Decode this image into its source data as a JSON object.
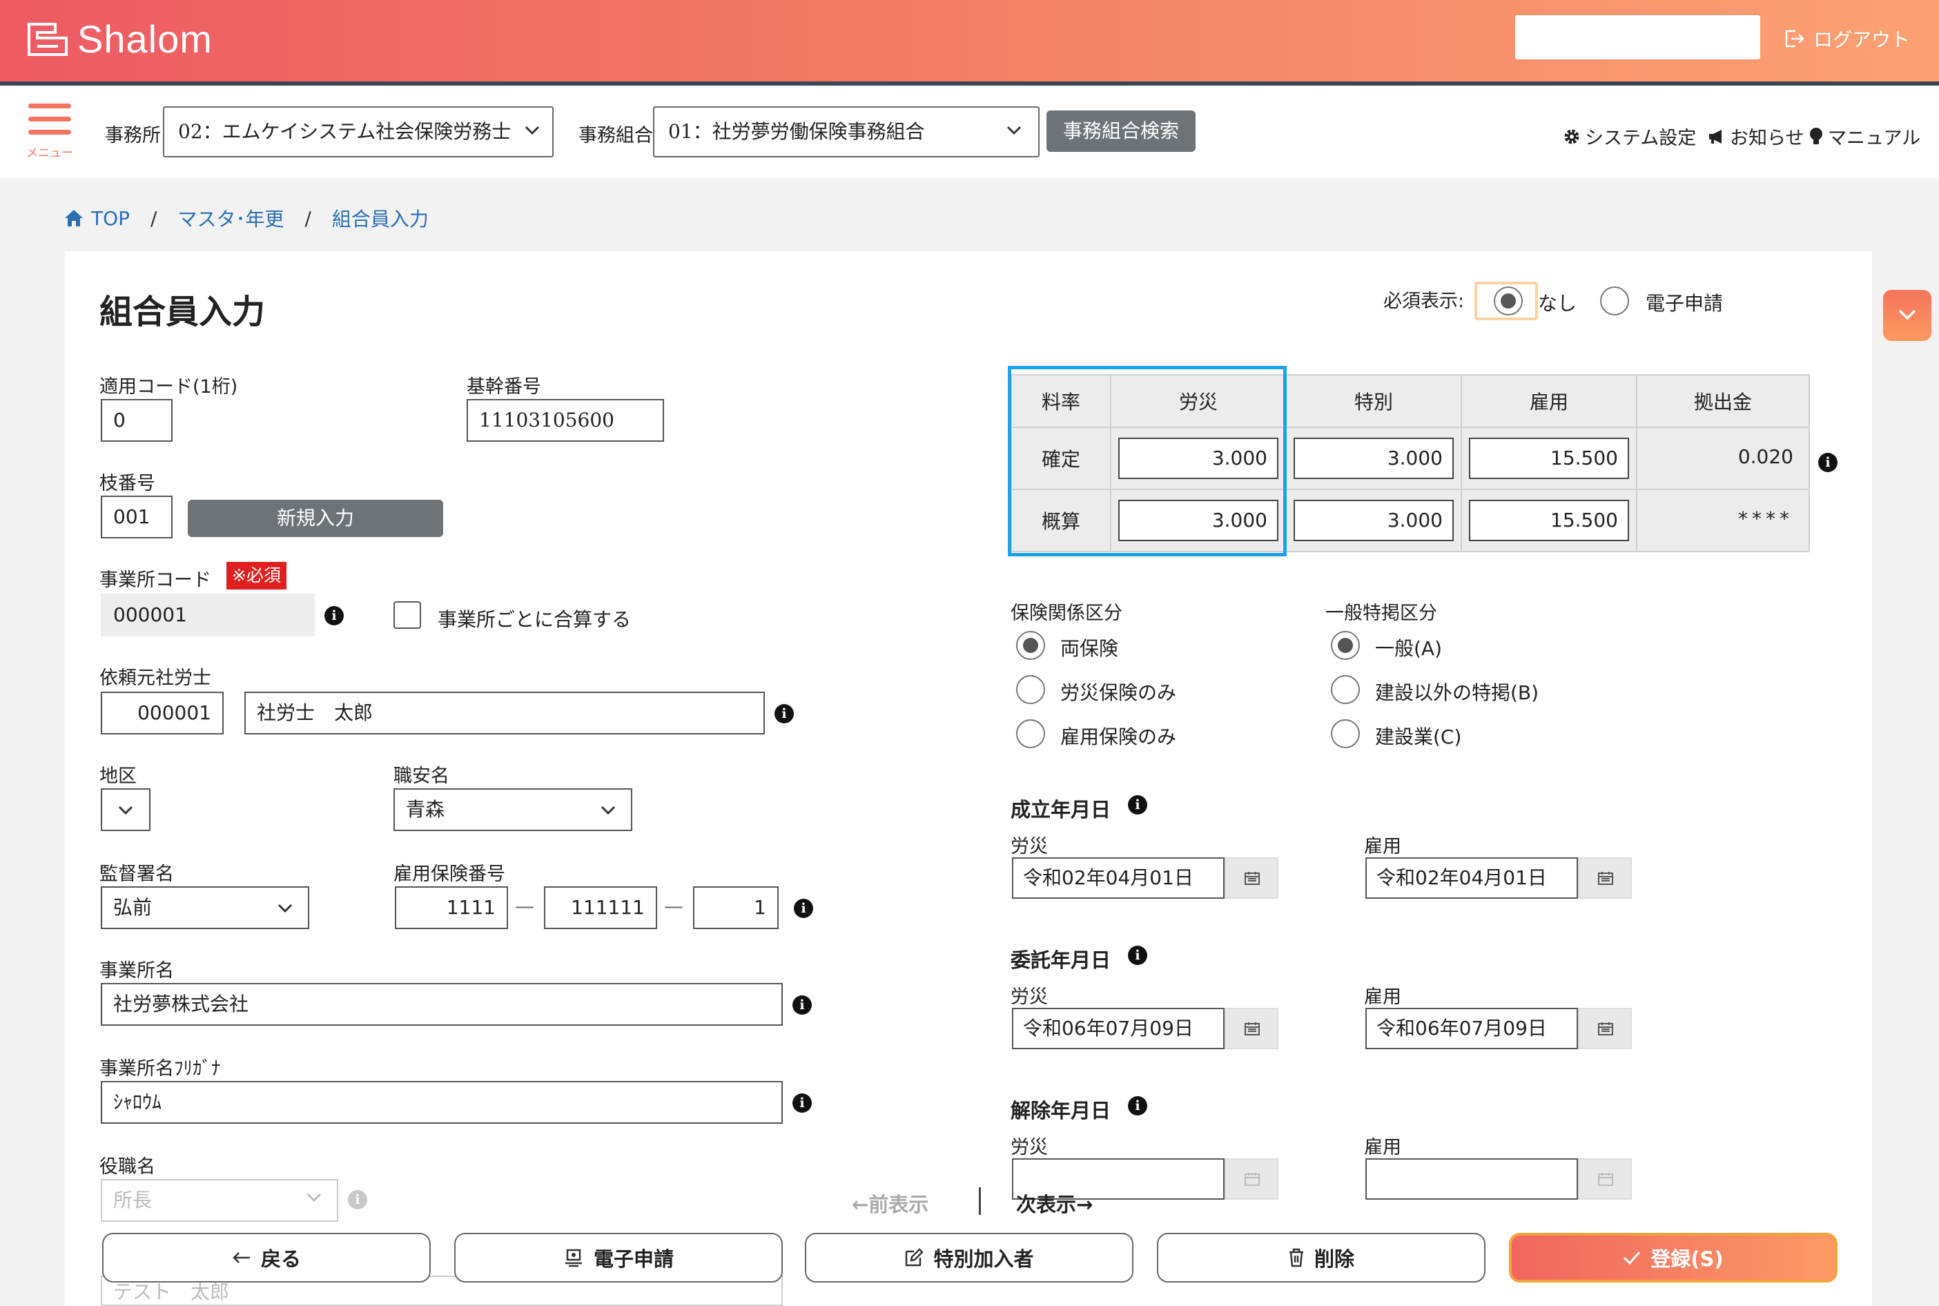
{
  "header": {
    "app_name": "Shalom",
    "logout_label": "ログアウト"
  },
  "toolbar": {
    "menu_label": "メニュー",
    "office_label": "事務所",
    "office_value": "02：エムケイシステム社会保険労務士",
    "union_label": "事務組合",
    "union_value": "01：社労夢労働保険事務組合",
    "union_search_label": "事務組合検索",
    "system_settings": "システム設定",
    "notice": "お知らせ",
    "manual": "マニュアル"
  },
  "breadcrumb": {
    "top": "TOP",
    "sep": "/",
    "master": "マスタ･年更",
    "current": "組合員入力"
  },
  "page": {
    "title": "組合員入力",
    "required_display_label": "必須表示:",
    "required_opt_none": "なし",
    "required_opt_electronic": "電子申請"
  },
  "form": {
    "apply_code_label": "適用コード(1桁)",
    "apply_code_value": "0",
    "base_no_label": "基幹番号",
    "base_no_value": "11103105600",
    "branch_no_label": "枝番号",
    "branch_no_value": "001",
    "new_entry_label": "新規入力",
    "office_code_label": "事業所コード",
    "required_badge": "※必須",
    "office_code_value": "000001",
    "merge_label": "事業所ごとに合算する",
    "client_label": "依頼元社労士",
    "client_code": "000001",
    "client_name": "社労士　太郎",
    "district_label": "地区",
    "job_office_label": "職安名",
    "job_office_value": "青森",
    "supervision_label": "監督署名",
    "supervision_value": "弘前",
    "emp_ins_no_label": "雇用保険番号",
    "emp_ins_no_1": "1111",
    "emp_ins_no_2": "111111",
    "emp_ins_no_3": "1",
    "dash": "—",
    "office_name_label": "事業所名",
    "office_name_value": "社労夢株式会社",
    "office_kana_label": "事業所名ﾌﾘｶﾞﾅ",
    "office_kana_value": "ｼｬﾛｳﾑ",
    "position_label": "役職名",
    "position_value": "所長",
    "rep_name_value": "テスト　太郎"
  },
  "rates": {
    "headers": [
      "料率",
      "労災",
      "特別",
      "雇用",
      "拠出金"
    ],
    "confirmed_label": "確定",
    "estimated_label": "概算",
    "confirmed": [
      "3.000",
      "3.000",
      "15.500",
      "0.020"
    ],
    "estimated": [
      "3.000",
      "3.000",
      "15.500",
      "****"
    ]
  },
  "insurance": {
    "type_label": "保険関係区分",
    "type_options": [
      "両保険",
      "労災保険のみ",
      "雇用保険のみ"
    ],
    "special_label": "一般特掲区分",
    "special_options": [
      "一般(A)",
      "建設以外の特掲(B)",
      "建設業(C)"
    ]
  },
  "dates": {
    "established_label": "成立年月日",
    "entrusted_label": "委託年月日",
    "terminated_label": "解除年月日",
    "rousai_label": "労災",
    "koyou_label": "雇用",
    "established_rousai": "令和02年04月01日",
    "established_koyou": "令和02年04月01日",
    "entrusted_rousai": "令和06年07月09日",
    "entrusted_koyou": "令和06年07月09日"
  },
  "pager": {
    "prev": "←前表示",
    "next": "次表示→"
  },
  "actions": {
    "back": "戻る",
    "electronic": "電子申請",
    "special_joiner": "特別加入者",
    "delete": "削除",
    "register": "登録(S)"
  },
  "colors": {
    "accent": "#f17c64",
    "highlight": "#1aa3e8",
    "required": "#e02020"
  }
}
